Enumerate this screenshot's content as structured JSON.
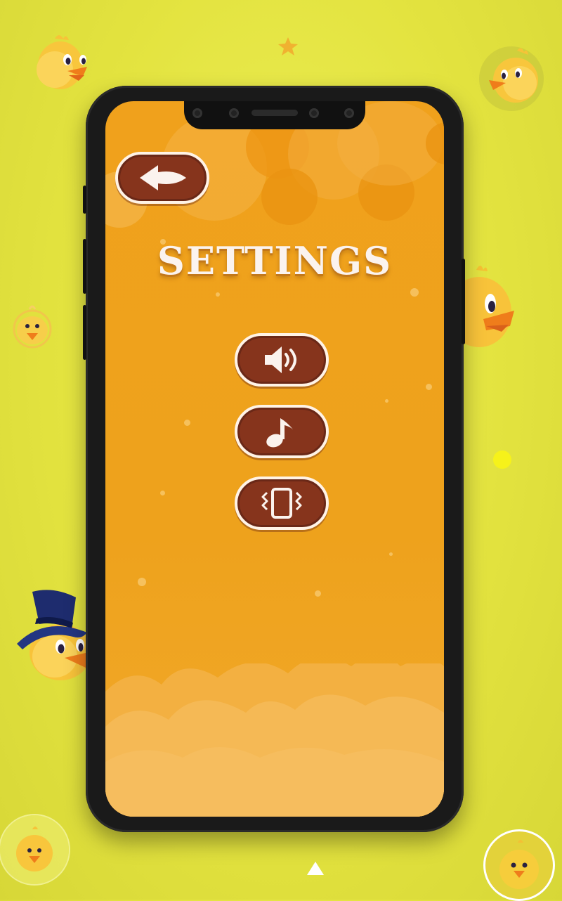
{
  "screen": {
    "title": "SETTINGS"
  },
  "buttons": {
    "back": {
      "icon": "back-arrow-icon"
    },
    "sound": {
      "icon": "speaker-icon"
    },
    "music": {
      "icon": "music-note-icon"
    },
    "vibration": {
      "icon": "vibrate-phone-icon"
    }
  },
  "colors": {
    "background": "#e3e33f",
    "screen": "#eea21c",
    "button_fill": "#86341c",
    "button_border": "#fff3e6",
    "title_text": "#fbf3ee"
  },
  "decorations": {
    "icons": [
      "chick-icon",
      "chick-with-hat-icon",
      "star-icon"
    ],
    "nav": [
      "home-chick-button",
      "nav-up-arrow-icon"
    ]
  }
}
